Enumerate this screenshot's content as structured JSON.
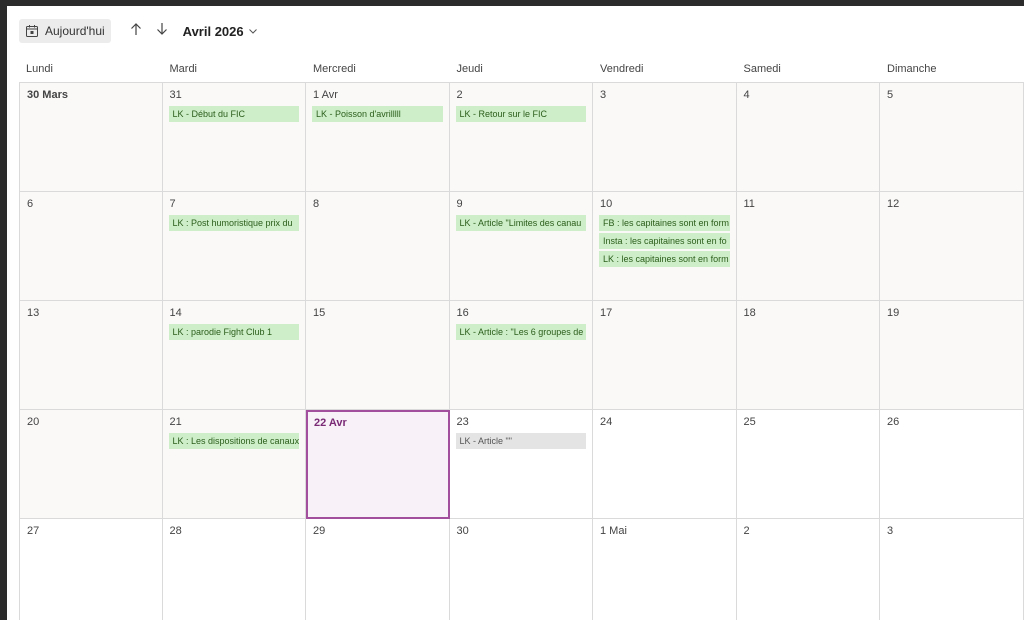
{
  "toolbar": {
    "today_label": "Aujourd'hui",
    "month_label": "Avril 2026"
  },
  "weekdays": [
    "Lundi",
    "Mardi",
    "Mercredi",
    "Jeudi",
    "Vendredi",
    "Samedi",
    "Dimanche"
  ],
  "weeks": [
    [
      {
        "day": "30 Mars",
        "past": true,
        "events": []
      },
      {
        "day": "31",
        "past": true,
        "events": [
          {
            "text": "LK - Début du FIC",
            "color": "green"
          }
        ]
      },
      {
        "day": "1 Avr",
        "past": true,
        "events": [
          {
            "text": "LK - Poisson d'avrilllll",
            "color": "green"
          }
        ]
      },
      {
        "day": "2",
        "past": true,
        "events": [
          {
            "text": "LK - Retour sur le FIC",
            "color": "green"
          }
        ]
      },
      {
        "day": "3",
        "past": true,
        "events": []
      },
      {
        "day": "4",
        "past": true,
        "events": []
      },
      {
        "day": "5",
        "past": true,
        "events": []
      }
    ],
    [
      {
        "day": "6",
        "past": true,
        "events": []
      },
      {
        "day": "7",
        "past": true,
        "events": [
          {
            "text": "LK : Post humoristique prix du",
            "color": "green"
          }
        ]
      },
      {
        "day": "8",
        "past": true,
        "events": []
      },
      {
        "day": "9",
        "past": true,
        "events": [
          {
            "text": "LK - Article \"Limites des canau",
            "color": "green"
          }
        ]
      },
      {
        "day": "10",
        "past": true,
        "events": [
          {
            "text": "FB : les capitaines sont en form",
            "color": "green"
          },
          {
            "text": "Insta : les capitaines sont en fo",
            "color": "green"
          },
          {
            "text": "LK : les capitaines sont en form",
            "color": "green"
          }
        ]
      },
      {
        "day": "11",
        "past": true,
        "events": []
      },
      {
        "day": "12",
        "past": true,
        "events": []
      }
    ],
    [
      {
        "day": "13",
        "past": true,
        "events": []
      },
      {
        "day": "14",
        "past": true,
        "events": [
          {
            "text": "LK : parodie Fight Club 1",
            "color": "green"
          }
        ]
      },
      {
        "day": "15",
        "past": true,
        "events": []
      },
      {
        "day": "16",
        "past": true,
        "events": [
          {
            "text": "LK - Article : \"Les 6 groupes de",
            "color": "green"
          }
        ]
      },
      {
        "day": "17",
        "past": true,
        "events": []
      },
      {
        "day": "18",
        "past": true,
        "events": []
      },
      {
        "day": "19",
        "past": true,
        "events": []
      }
    ],
    [
      {
        "day": "20",
        "past": true,
        "events": []
      },
      {
        "day": "21",
        "past": true,
        "events": [
          {
            "text": "LK : Les dispositions de canaux",
            "color": "green"
          }
        ]
      },
      {
        "day": "22 Avr",
        "today": true,
        "events": []
      },
      {
        "day": "23",
        "past": false,
        "events": [
          {
            "text": "LK - Article \"\"",
            "color": "gray"
          }
        ]
      },
      {
        "day": "24",
        "past": false,
        "events": []
      },
      {
        "day": "25",
        "past": false,
        "events": []
      },
      {
        "day": "26",
        "past": false,
        "events": []
      }
    ],
    [
      {
        "day": "27",
        "past": false,
        "events": []
      },
      {
        "day": "28",
        "past": false,
        "events": []
      },
      {
        "day": "29",
        "past": false,
        "events": []
      },
      {
        "day": "30",
        "past": false,
        "events": []
      },
      {
        "day": "1 Mai",
        "past": false,
        "events": []
      },
      {
        "day": "2",
        "past": false,
        "events": []
      },
      {
        "day": "3",
        "past": false,
        "events": []
      }
    ]
  ]
}
